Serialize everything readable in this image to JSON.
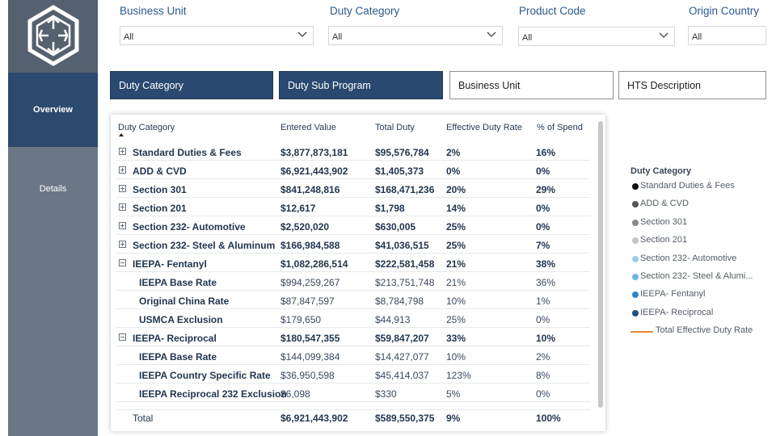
{
  "filters": [
    {
      "label": "Business Unit",
      "value": "All"
    },
    {
      "label": "Duty Category",
      "value": "All"
    },
    {
      "label": "Product Code",
      "value": "All"
    },
    {
      "label": "Origin Country",
      "value": "All"
    }
  ],
  "nav": {
    "overview": "Overview",
    "details": "Details"
  },
  "tabs": [
    {
      "label": "Duty Category",
      "active": true
    },
    {
      "label": "Duty Sub Program",
      "active": true
    },
    {
      "label": "Business Unit",
      "active": false
    },
    {
      "label": "HTS Description",
      "active": false
    }
  ],
  "table": {
    "headers": [
      "Duty Category",
      "Entered Value",
      "Total Duty",
      "Effective Duty Rate",
      "% of Spend"
    ],
    "rows": [
      {
        "name": "Standard Duties & Fees",
        "entered": "$3,877,873,181",
        "duty": "$95,576,784",
        "rate": "2%",
        "spend": "16%",
        "level": 0,
        "expander": "plus"
      },
      {
        "name": "ADD & CVD",
        "entered": "$6,921,443,902",
        "duty": "$1,405,373",
        "rate": "0%",
        "spend": "0%",
        "level": 0,
        "expander": "plus"
      },
      {
        "name": "Section 301",
        "entered": "$841,248,816",
        "duty": "$168,471,236",
        "rate": "20%",
        "spend": "29%",
        "level": 0,
        "expander": "plus"
      },
      {
        "name": "Section 201",
        "entered": "$12,617",
        "duty": "$1,798",
        "rate": "14%",
        "spend": "0%",
        "level": 0,
        "expander": "plus"
      },
      {
        "name": "Section 232- Automotive",
        "entered": "$2,520,020",
        "duty": "$630,005",
        "rate": "25%",
        "spend": "0%",
        "level": 0,
        "expander": "plus"
      },
      {
        "name": "Section 232- Steel & Aluminum",
        "entered": "$166,984,588",
        "duty": "$41,036,515",
        "rate": "25%",
        "spend": "7%",
        "level": 0,
        "expander": "plus"
      },
      {
        "name": "IEEPA- Fentanyl",
        "entered": "$1,082,286,514",
        "duty": "$222,581,458",
        "rate": "21%",
        "spend": "38%",
        "level": 0,
        "expander": "minus"
      },
      {
        "name": "IEEPA Base Rate",
        "entered": "$994,259,267",
        "duty": "$213,751,748",
        "rate": "21%",
        "spend": "36%",
        "level": 1,
        "expander": ""
      },
      {
        "name": "Original China Rate",
        "entered": "$87,847,597",
        "duty": "$8,784,798",
        "rate": "10%",
        "spend": "1%",
        "level": 1,
        "expander": ""
      },
      {
        "name": "USMCA Exclusion",
        "entered": "$179,650",
        "duty": "$44,913",
        "rate": "25%",
        "spend": "0%",
        "level": 1,
        "expander": ""
      },
      {
        "name": "IEEPA- Reciprocal",
        "entered": "$180,547,355",
        "duty": "$59,847,207",
        "rate": "33%",
        "spend": "10%",
        "level": 0,
        "expander": "minus"
      },
      {
        "name": "IEEPA Base Rate",
        "entered": "$144,099,384",
        "duty": "$14,427,077",
        "rate": "10%",
        "spend": "2%",
        "level": 1,
        "expander": ""
      },
      {
        "name": "IEEPA Country Specific Rate",
        "entered": "$36,950,598",
        "duty": "$45,414,037",
        "rate": "123%",
        "spend": "8%",
        "level": 1,
        "expander": ""
      },
      {
        "name": "IEEPA Reciprocal 232 Exclusion",
        "entered": "$6,098",
        "duty": "$330",
        "rate": "5%",
        "spend": "0%",
        "level": 1,
        "expander": ""
      }
    ],
    "total": {
      "label": "Total",
      "entered": "$6,921,443,902",
      "duty": "$589,550,375",
      "rate": "9%",
      "spend": "100%"
    }
  },
  "legend": {
    "title": "Duty Category",
    "items": [
      {
        "label": "Standard Duties & Fees",
        "color": "#111111",
        "kind": "dot"
      },
      {
        "label": "ADD & CVD",
        "color": "#555555",
        "kind": "dot"
      },
      {
        "label": "Section 301",
        "color": "#888888",
        "kind": "dot"
      },
      {
        "label": "Section 201",
        "color": "#c4c4c4",
        "kind": "dot"
      },
      {
        "label": "Section 232- Automotive",
        "color": "#9ccbec",
        "kind": "dot"
      },
      {
        "label": "Section 232- Steel & Alumi...",
        "color": "#6db3e6",
        "kind": "dot"
      },
      {
        "label": "IEEPA- Fentanyl",
        "color": "#2f86d0",
        "kind": "dot"
      },
      {
        "label": "IEEPA- Reciprocal",
        "color": "#1f4e8a",
        "kind": "dot"
      },
      {
        "label": "Total Effective Duty Rate",
        "color": "#e8883a",
        "kind": "line"
      }
    ]
  }
}
